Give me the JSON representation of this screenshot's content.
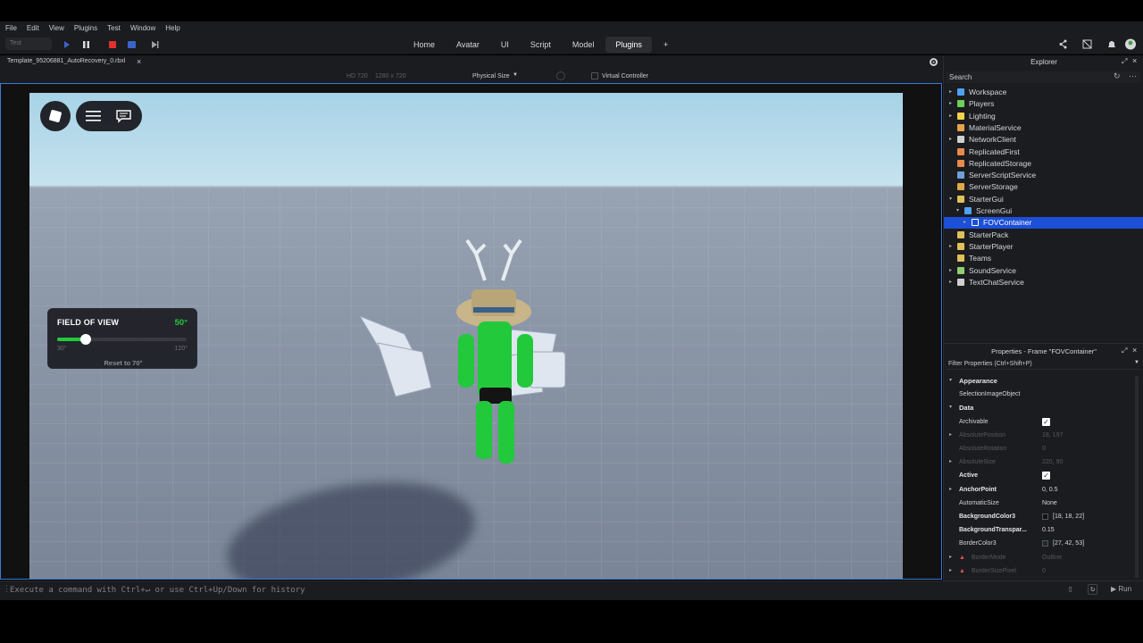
{
  "menu": [
    "File",
    "Edit",
    "View",
    "Plugins",
    "Test",
    "Window",
    "Help"
  ],
  "toolbar": {
    "test_label": "Test",
    "tabs": [
      "Home",
      "Avatar",
      "UI",
      "Script",
      "Model",
      "Plugins"
    ],
    "active_tab": "Plugins",
    "add_tab": "+"
  },
  "file_tab": {
    "name": "Template_95206881_AutoRecovery_0.rbxl",
    "close": "×"
  },
  "viewport_header": {
    "resolution": "HD 720",
    "size": "1280 x 720",
    "physical_size": "Physical Size",
    "virtual_controller": "Virtual Controller"
  },
  "fov": {
    "title": "FIELD OF VIEW",
    "value_label": "50°",
    "min_label": "30°",
    "max_label": "120°",
    "reset_label": "Reset to 70°",
    "min": 30,
    "max": 120,
    "value": 50
  },
  "console": {
    "placeholder": "Execute a command with Ctrl+↵ or use Ctrl+Up/Down for history",
    "run_label": "Run"
  },
  "explorer": {
    "title": "Explorer",
    "search_placeholder": "Search",
    "items": [
      {
        "label": "Workspace",
        "icon": "workspace-icon",
        "color": "#4ea1f3",
        "depth": 0,
        "arrow": "▸"
      },
      {
        "label": "Players",
        "icon": "players-icon",
        "color": "#6fcf57",
        "depth": 0,
        "arrow": "▸"
      },
      {
        "label": "Lighting",
        "icon": "lighting-icon",
        "color": "#f2d34a",
        "depth": 0,
        "arrow": "▸"
      },
      {
        "label": "MaterialService",
        "icon": "material-service-icon",
        "color": "#e8a24a",
        "depth": 0,
        "arrow": ""
      },
      {
        "label": "NetworkClient",
        "icon": "network-client-icon",
        "color": "#cfcfcf",
        "depth": 0,
        "arrow": "▸"
      },
      {
        "label": "ReplicatedFirst",
        "icon": "replicated-first-icon",
        "color": "#e88a4a",
        "depth": 0,
        "arrow": ""
      },
      {
        "label": "ReplicatedStorage",
        "icon": "replicated-storage-icon",
        "color": "#e88a4a",
        "depth": 0,
        "arrow": ""
      },
      {
        "label": "ServerScriptService",
        "icon": "server-script-service-icon",
        "color": "#6fa0d8",
        "depth": 0,
        "arrow": ""
      },
      {
        "label": "ServerStorage",
        "icon": "server-storage-icon",
        "color": "#e0a847",
        "depth": 0,
        "arrow": ""
      },
      {
        "label": "StarterGui",
        "icon": "starter-gui-icon",
        "color": "#e0c15a",
        "depth": 0,
        "arrow": "▾"
      },
      {
        "label": "ScreenGui",
        "icon": "screen-gui-icon",
        "color": "#4ea1f3",
        "depth": 1,
        "arrow": "▾"
      },
      {
        "label": "FOVContainer",
        "icon": "frame-icon",
        "color": "#1d50d8",
        "depth": 2,
        "arrow": "▸",
        "selected": true
      },
      {
        "label": "StarterPack",
        "icon": "starter-pack-icon",
        "color": "#e0c15a",
        "depth": 0,
        "arrow": ""
      },
      {
        "label": "StarterPlayer",
        "icon": "starter-player-icon",
        "color": "#e0c15a",
        "depth": 0,
        "arrow": "▸"
      },
      {
        "label": "Teams",
        "icon": "teams-icon",
        "color": "#e0c15a",
        "depth": 0,
        "arrow": ""
      },
      {
        "label": "SoundService",
        "icon": "sound-service-icon",
        "color": "#8fcf6f",
        "depth": 0,
        "arrow": "▸"
      },
      {
        "label": "TextChatService",
        "icon": "text-chat-service-icon",
        "color": "#cfcfcf",
        "depth": 0,
        "arrow": "▸"
      }
    ]
  },
  "properties": {
    "title": "Properties - Frame \"FOVContainer\"",
    "filter_placeholder": "Filter Properties (Ctrl+Shift+P)",
    "rows": [
      {
        "kind": "section",
        "name": "Appearance",
        "arrow": "▾"
      },
      {
        "kind": "prop",
        "name": "SelectionImageObject",
        "value": ""
      },
      {
        "kind": "section",
        "name": "Data",
        "arrow": "▾"
      },
      {
        "kind": "prop",
        "name": "Archivable",
        "check": true
      },
      {
        "kind": "prop",
        "name": "AbsolutePosition",
        "value": "18, 197",
        "dim": true,
        "arrow": "▸"
      },
      {
        "kind": "prop",
        "name": "AbsoluteRotation",
        "value": "0",
        "dim": true
      },
      {
        "kind": "prop",
        "name": "AbsoluteSize",
        "value": "220, 90",
        "dim": true,
        "arrow": "▸"
      },
      {
        "kind": "prop",
        "name": "Active",
        "check": true,
        "bold": true
      },
      {
        "kind": "prop",
        "name": "AnchorPoint",
        "value": "0, 0.5",
        "bold": true,
        "arrow": "▸"
      },
      {
        "kind": "prop",
        "name": "AutomaticSize",
        "value": "None"
      },
      {
        "kind": "prop",
        "name": "BackgroundColor3",
        "value": "[18, 18, 22]",
        "bold": true,
        "swatch": "#121216"
      },
      {
        "kind": "prop",
        "name": "BackgroundTranspar...",
        "value": "0.15",
        "bold": true
      },
      {
        "kind": "prop",
        "name": "BorderColor3",
        "value": "[27, 42, 53]",
        "swatch": "#1b2a35"
      },
      {
        "kind": "prop",
        "name": "BorderMode",
        "value": "Outline",
        "dim": true,
        "warn": true,
        "arrow": "▸"
      },
      {
        "kind": "prop",
        "name": "BorderSizePixel",
        "value": "0",
        "dim": true,
        "warn": true,
        "arrow": "▸"
      }
    ]
  }
}
